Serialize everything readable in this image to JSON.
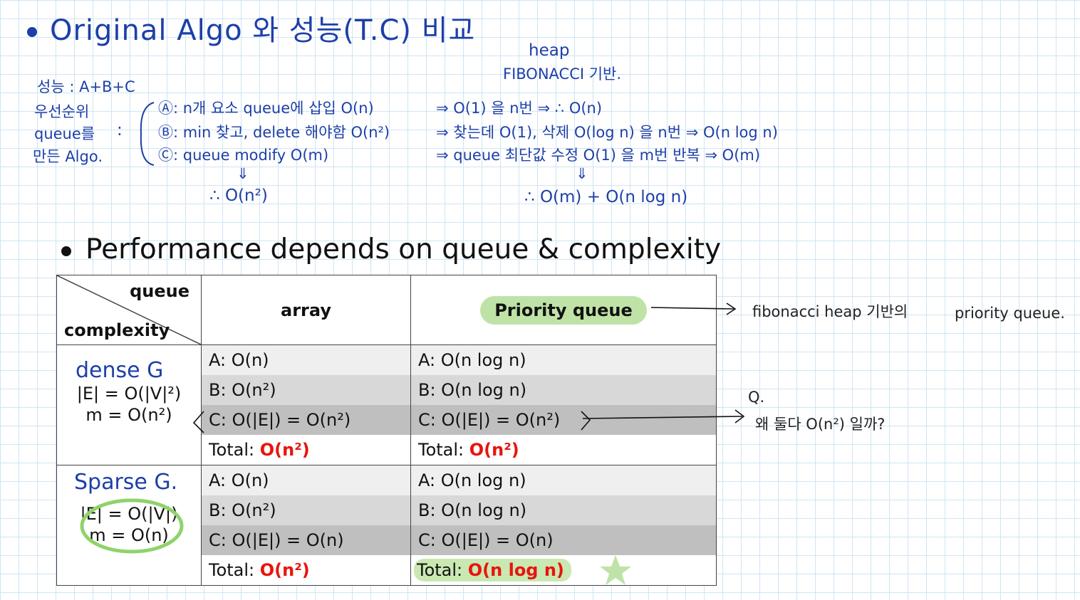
{
  "notes": {
    "title": "Original Algo 와 성능(T.C) 비교",
    "perf_formula": "성능 : A+B+C",
    "left_label_1": "우선순위",
    "left_label_2": "queue를",
    "left_label_3": "만든 Algo.",
    "colon": ":",
    "step_a": "Ⓐ: n개 요소 queue에 삽입 O(n)",
    "step_b": "Ⓑ: min 찾고, delete 해야함 O(n²)",
    "step_c": "Ⓒ: queue modify O(m)",
    "left_down_arrow": "⇓",
    "left_result": "∴ O(n²)",
    "heap_label": "heap",
    "fibonacci_label": "FIBONACCI 기반.",
    "right_a": "⇒ O(1) 을 n번 ⇒ ∴ O(n)",
    "right_b": "⇒ 찾는데 O(1), 삭제 O(log n) 을 n번 ⇒ O(n log n)",
    "right_c": "⇒ queue 최단값 수정 O(1) 을 m번 반복 ⇒ O(m)",
    "right_down_arrow": "⇓",
    "right_result": "∴ O(m) + O(n log n)",
    "fib_note": "fibonacci heap 기반의",
    "pq_note": "priority queue.",
    "q_label": "Q.",
    "q_text": "왜 둘다 O(n²) 일까?"
  },
  "heading": "Performance depends on queue & complexity",
  "table": {
    "corner_queue": "queue",
    "corner_complexity": "complexity",
    "col_array": "array",
    "col_pq": "Priority queue",
    "dense": {
      "hw_label": "dense G",
      "line1": "|E| = O(|V|²)",
      "line2": "m = O(n²)",
      "array": {
        "a": "A: O(n)",
        "b": "B: O(n²)",
        "c": "C: O(|E|) = O(n²)",
        "total_label": "Total:",
        "total": "O(n²)"
      },
      "pq": {
        "a": "A: O(n log n)",
        "b": "B: O(n log n)",
        "c": "C: O(|E|) = O(n²)",
        "total_label": "Total:",
        "total": "O(n²)"
      }
    },
    "sparse": {
      "hw_label": "Sparse G.",
      "line1": "|E| = O(|V|)",
      "line2": "m = O(n)",
      "array": {
        "a": "A: O(n)",
        "b": "B: O(n²)",
        "c": "C: O(|E|) = O(n)",
        "total_label": "Total:",
        "total": "O(n²)"
      },
      "pq": {
        "a": "A: O(n log n)",
        "b": "B: O(n log n)",
        "c": "C: O(|E|) = O(n)",
        "total_label": "Total:",
        "total": "O(n log n)"
      }
    }
  },
  "colors": {
    "ink": "#1d3fa8",
    "red": "#e8140e",
    "highlight": "#bfe3a7",
    "grid": "#cfe5f3"
  }
}
